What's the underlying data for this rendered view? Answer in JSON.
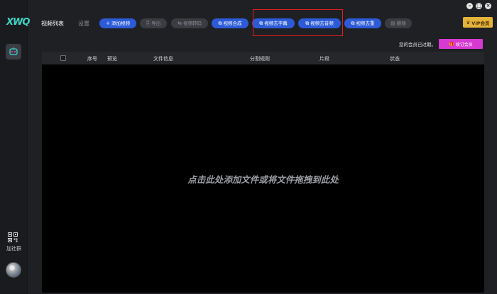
{
  "app": {
    "logo": "XWQ"
  },
  "sidebar": {
    "group_label": "加社群"
  },
  "window_controls": [
    "–",
    "□",
    "×"
  ],
  "tabs": {
    "video_list": "视频列表",
    "settings": "设置"
  },
  "toolbar": {
    "add_video": "添加视频",
    "export": "导出",
    "video_convert": "视频转码",
    "video_merge": "视频合成",
    "remove_subtitle": "视频去字幕",
    "remove_audio": "视频去音频",
    "dedupe": "视频去重",
    "delete": "删除"
  },
  "vip": {
    "label": "VIP会员"
  },
  "notice": {
    "expired": "您的会员已过期。",
    "renew": "续订会员"
  },
  "table": {
    "columns": {
      "index": "序号",
      "preview": "预览",
      "file_info": "文件信息",
      "split_rule": "分割规则",
      "segments": "片段",
      "status": "状态"
    },
    "empty_message": "点击此处添加文件或将文件拖拽到此处"
  },
  "colors": {
    "primary_button": "#2d5bd8",
    "disabled_button": "#3a3c42",
    "vip": "#e3b33a",
    "renew": "#d73ad2",
    "highlight": "#e21e1e",
    "accent": "#3fd6c6"
  }
}
